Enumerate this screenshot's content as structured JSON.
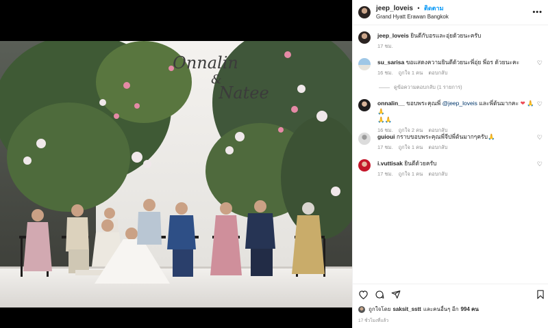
{
  "post": {
    "username": "jeep_loveis",
    "separator": "•",
    "follow_label": "ติดตาม",
    "location": "Grand Hyatt Erawan Bangkok",
    "more_label": "•••"
  },
  "photo": {
    "backdrop_text_line1": "Onnalin",
    "backdrop_text_amp": "&",
    "backdrop_text_line2": "Natee"
  },
  "caption": {
    "username": "jeep_loveis",
    "text": "ยินดีกับอรและอุ่ยด้วยนะครับ",
    "time": "17 ชม."
  },
  "comments": [
    {
      "username": "su_sarisa",
      "text": "ขอแสดงความยินดีด้วยนะพี่อุ่ย พี่อร ด้วยนะคะ",
      "time": "16 ชม.",
      "likes": "ถูกใจ 1 คน",
      "reply": "ตอบกลับ",
      "view_replies": "ดูข้อความตอบกลับ (1 รายการ)"
    },
    {
      "username": "onnalin__",
      "text_before": "ขอบพระคุณพี่",
      "mention": "@jeep_loveis",
      "text_after": "และพี่ต้นมากคะ",
      "emoji": "❤️ 🙏🙏",
      "emoji_line2": "🙏🙏",
      "time": "16 ชม.",
      "likes": "ถูกใจ 2 คน",
      "reply": "ตอบกลับ"
    },
    {
      "username": "guioui",
      "text": "กราบขอบพระคุณพี่จีปพี่ต้นมากๆครับ🙏",
      "time": "17 ชม.",
      "likes": "ถูกใจ 1 คน",
      "reply": "ตอบกลับ"
    },
    {
      "username": "i.vuttisak",
      "text": "ยินดีด้วยครับ",
      "time": "17 ชม.",
      "likes": "ถูกใจ 1 คน",
      "reply": "ตอบกลับ"
    }
  ],
  "likes": {
    "prefix": "ถูกใจโดย",
    "user": "saksit_sstt",
    "mid": "และคนอื่นๆ อีก",
    "count": "994 คน"
  },
  "timestamp": "17 ชั่วโมงที่แล้ว",
  "icons": [
    "heart-icon",
    "comment-icon",
    "share-icon",
    "bookmark-icon",
    "more-icon"
  ],
  "colors": {
    "link_blue": "#0095f6",
    "mention": "#00376b",
    "muted": "#8e8e8e",
    "heart_red": "#ed4956"
  }
}
